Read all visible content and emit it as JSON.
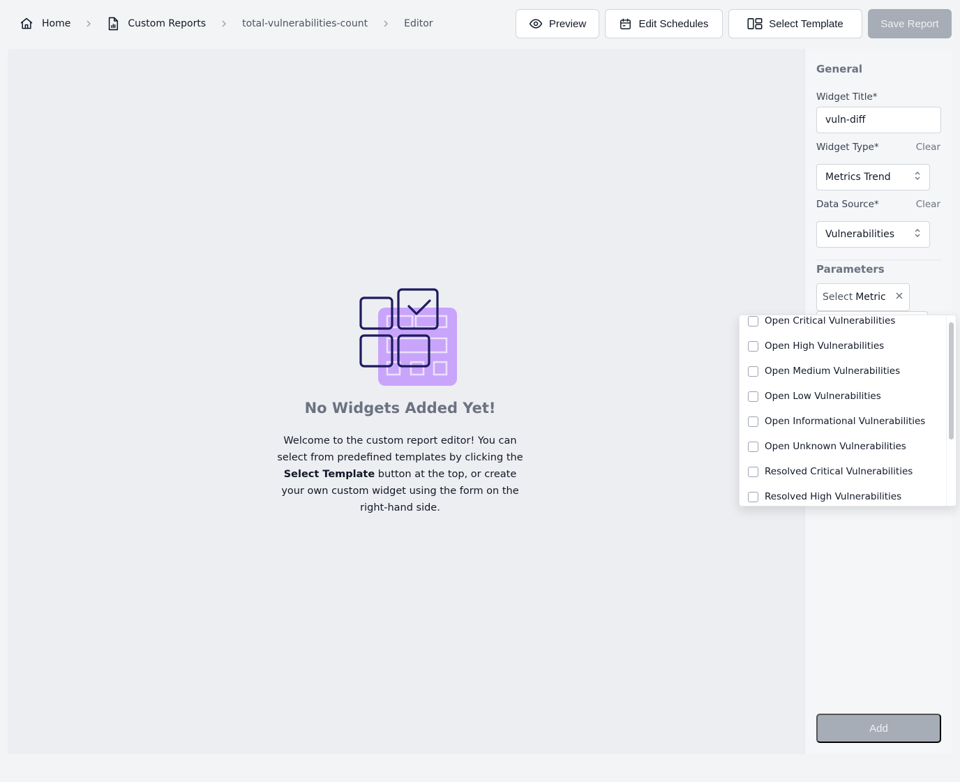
{
  "breadcrumb": {
    "home": "Home",
    "custom_reports": "Custom Reports",
    "report": "total-vulnerabilities-count",
    "editor": "Editor"
  },
  "toolbar": {
    "preview_label": "Preview",
    "edit_schedules_label": "Edit Schedules",
    "select_template_label": "Select Template",
    "save_report_label": "Save Report"
  },
  "canvas": {
    "empty_title": "No Widgets Added Yet!",
    "empty_text_before": "Welcome to the custom report editor! You can select from predefined templates by clicking the",
    "empty_text_bold": "Select Template",
    "empty_text_after": "button at the top, or create your own custom widget using the form on the right-hand side."
  },
  "panel": {
    "general_title": "General",
    "widget_title_label": "Widget Title*",
    "widget_title_value": "vuln-diff",
    "widget_type_label": "Widget Type*",
    "widget_type_clear": "Clear",
    "widget_type_value": "Metrics Trend",
    "data_source_label": "Data Source*",
    "data_source_clear": "Clear",
    "data_source_value": "Vulnerabilities",
    "parameters_title": "Parameters",
    "metric_placeholder": "Select",
    "metric_word": "Metric",
    "add_label": "Add"
  },
  "dropdown": {
    "items": [
      {
        "label": "Open Critical Vulnerabilities",
        "checked": false
      },
      {
        "label": "Open High Vulnerabilities",
        "checked": false
      },
      {
        "label": "Open Medium Vulnerabilities",
        "checked": false
      },
      {
        "label": "Open Low Vulnerabilities",
        "checked": false
      },
      {
        "label": "Open Informational Vulnerabilities",
        "checked": false
      },
      {
        "label": "Open Unknown Vulnerabilities",
        "checked": false
      },
      {
        "label": "Resolved Critical Vulnerabilities",
        "checked": false
      },
      {
        "label": "Resolved High Vulnerabilities",
        "checked": false
      }
    ]
  },
  "colors": {
    "illustration_purple": "#c9a4fb",
    "illustration_navy": "#1e1b5e",
    "disabled_button": "#a7adb6"
  },
  "icons": {
    "home": "home-icon",
    "reports": "report-file-icon",
    "separator": "chevron-right-icon",
    "preview": "eye-icon",
    "schedules": "calendar-icon",
    "template": "layout-template-icon",
    "select_arrows": "chevron-up-down-icon",
    "remove": "close-icon",
    "empty_state": "widgets-illustration"
  }
}
